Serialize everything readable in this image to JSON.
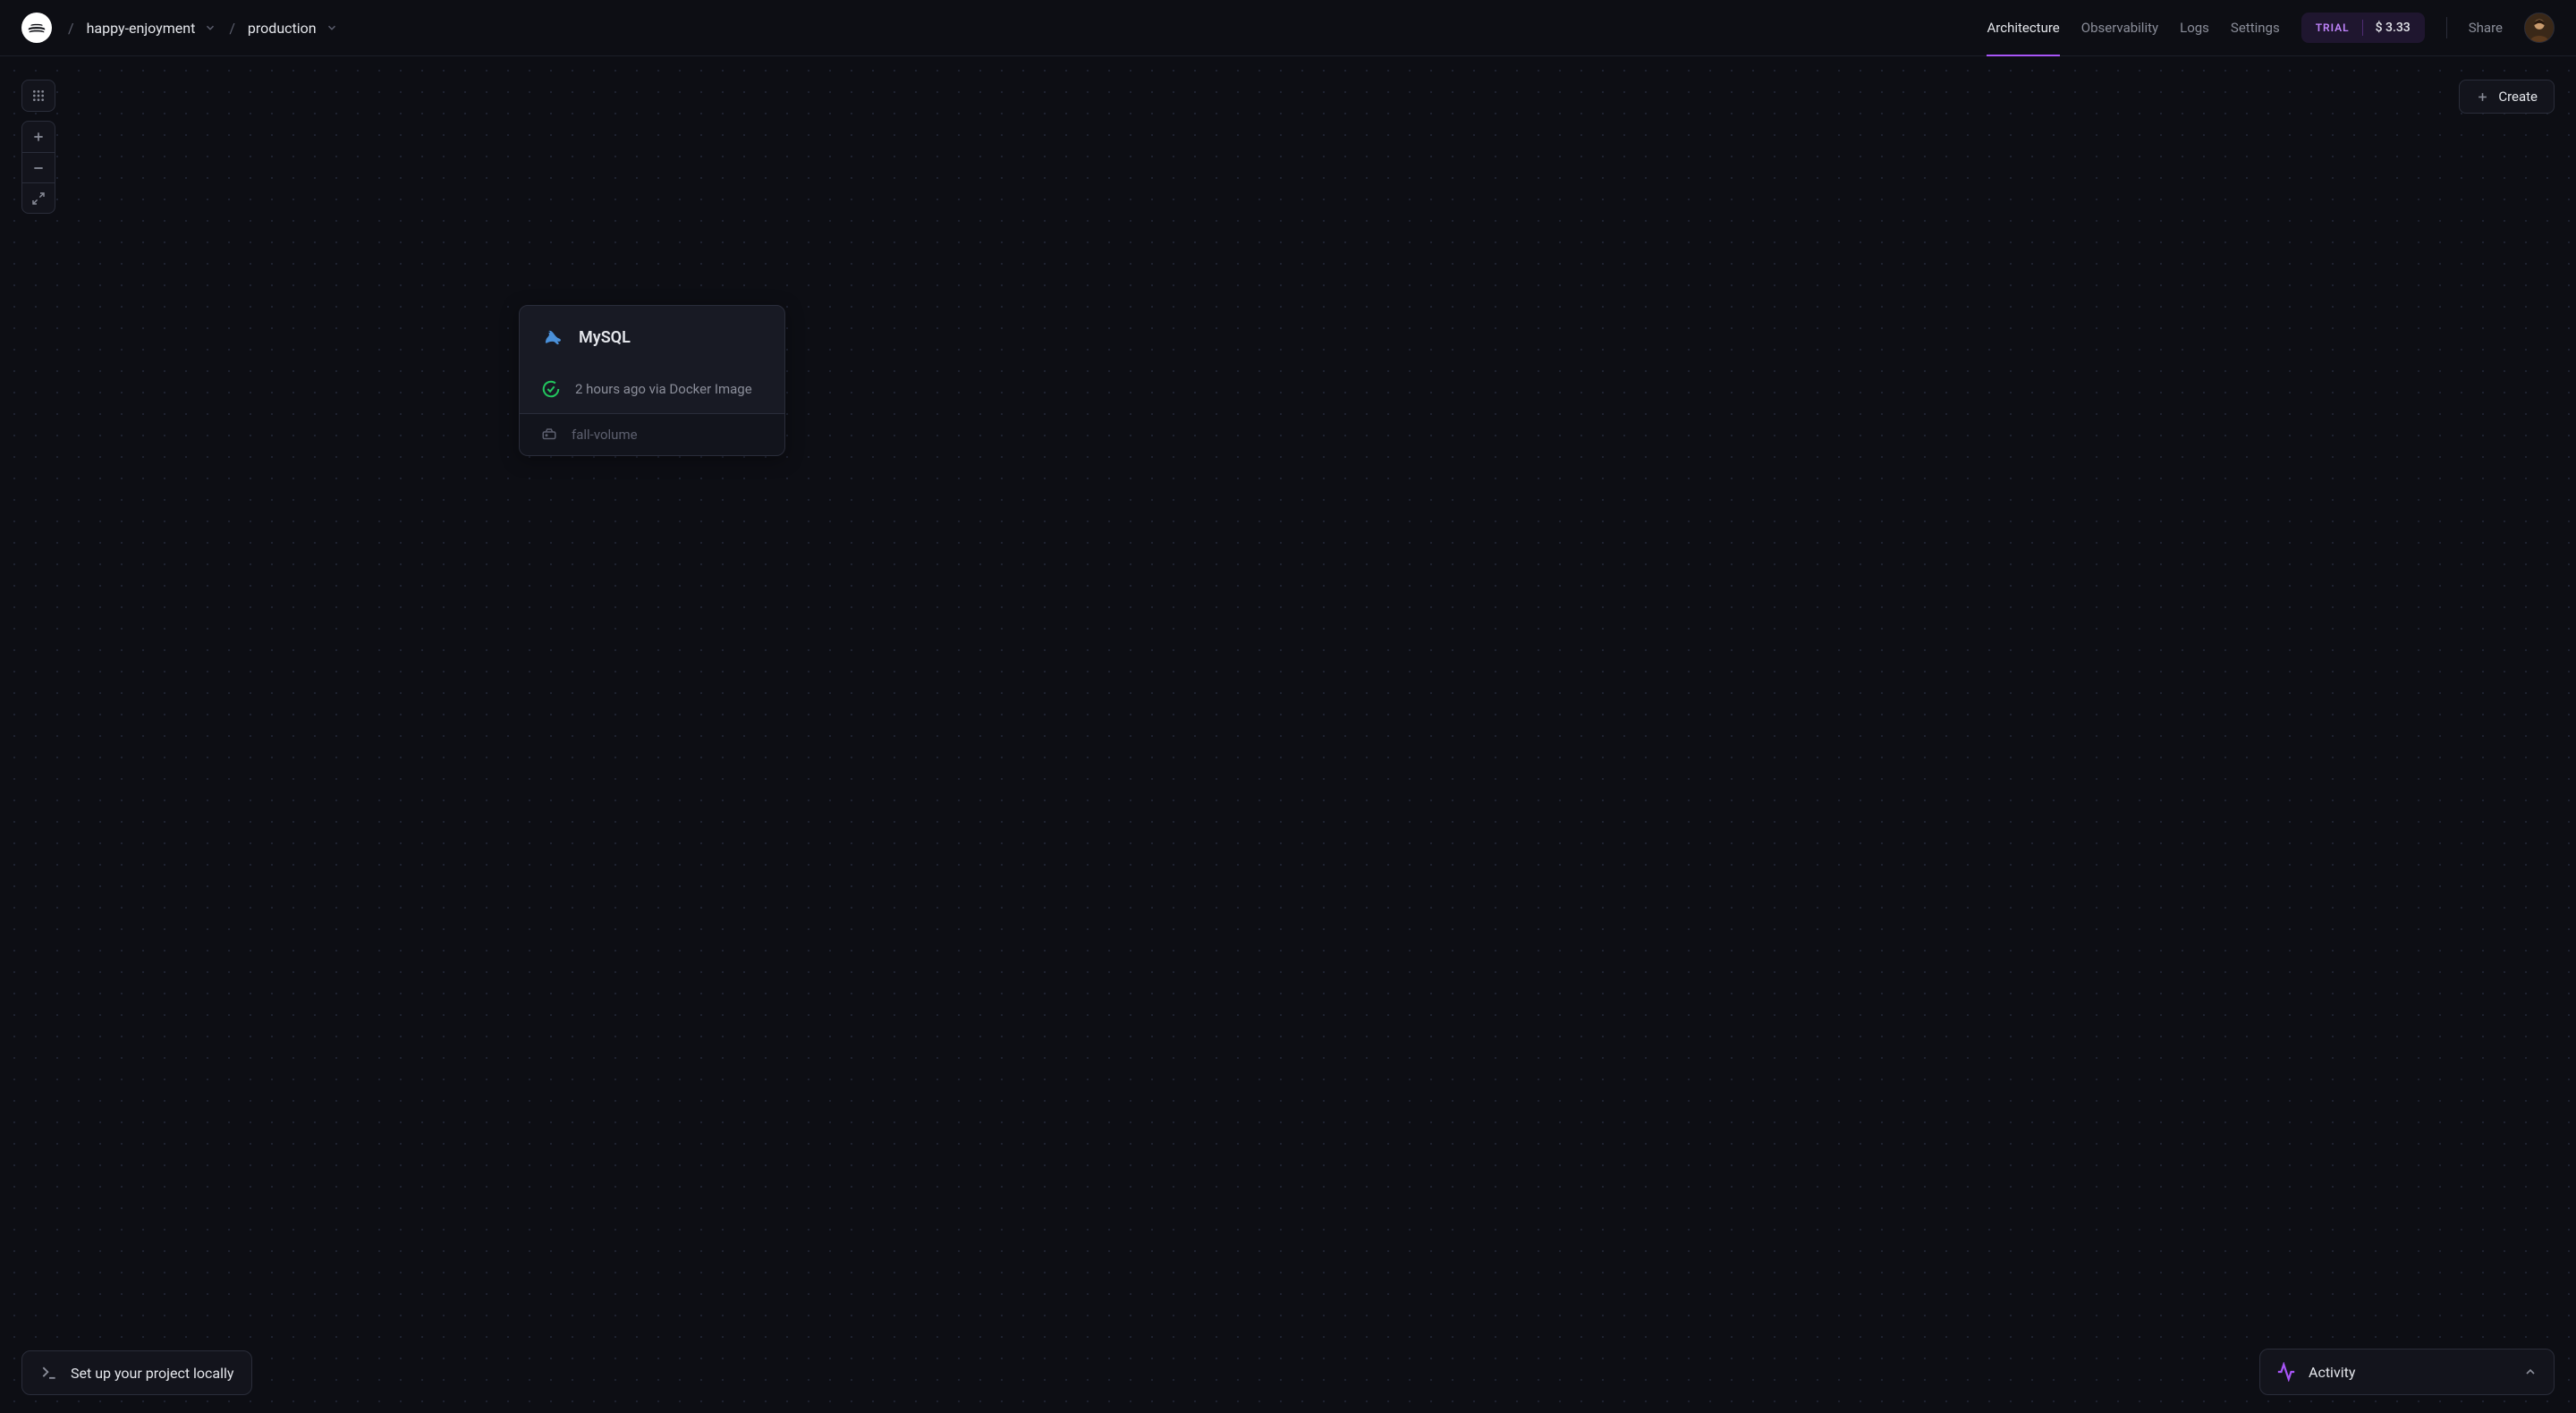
{
  "header": {
    "breadcrumb": {
      "project": "happy-enjoyment",
      "environment": "production"
    },
    "tabs": [
      {
        "label": "Architecture",
        "active": true
      },
      {
        "label": "Observability",
        "active": false
      },
      {
        "label": "Logs",
        "active": false
      },
      {
        "label": "Settings",
        "active": false
      }
    ],
    "trial": {
      "badge": "TRIAL",
      "amount": "$ 3.33"
    },
    "share_label": "Share"
  },
  "canvas": {
    "create_label": "Create",
    "node": {
      "service_name": "MySQL",
      "service_icon": "mysql-dolphin",
      "status_text": "2 hours ago via Docker Image",
      "status_state": "success",
      "volume_name": "fall-volume"
    }
  },
  "bottom": {
    "local_setup_label": "Set up your project locally",
    "activity_label": "Activity"
  },
  "colors": {
    "accent": "#a855f7",
    "success": "#22c55e",
    "mysql_blue": "#4a90d9"
  }
}
